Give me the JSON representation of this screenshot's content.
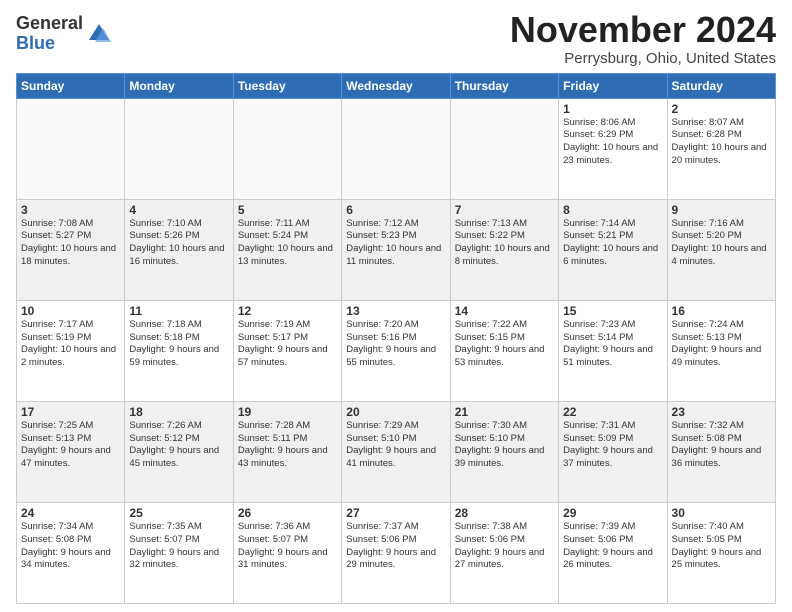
{
  "header": {
    "logo_general": "General",
    "logo_blue": "Blue",
    "month_title": "November 2024",
    "location": "Perrysburg, Ohio, United States"
  },
  "weekdays": [
    "Sunday",
    "Monday",
    "Tuesday",
    "Wednesday",
    "Thursday",
    "Friday",
    "Saturday"
  ],
  "weeks": [
    [
      {
        "day": "",
        "info": ""
      },
      {
        "day": "",
        "info": ""
      },
      {
        "day": "",
        "info": ""
      },
      {
        "day": "",
        "info": ""
      },
      {
        "day": "",
        "info": ""
      },
      {
        "day": "1",
        "info": "Sunrise: 8:06 AM\nSunset: 6:29 PM\nDaylight: 10 hours\nand 23 minutes."
      },
      {
        "day": "2",
        "info": "Sunrise: 8:07 AM\nSunset: 6:28 PM\nDaylight: 10 hours\nand 20 minutes."
      }
    ],
    [
      {
        "day": "3",
        "info": "Sunrise: 7:08 AM\nSunset: 5:27 PM\nDaylight: 10 hours\nand 18 minutes."
      },
      {
        "day": "4",
        "info": "Sunrise: 7:10 AM\nSunset: 5:26 PM\nDaylight: 10 hours\nand 16 minutes."
      },
      {
        "day": "5",
        "info": "Sunrise: 7:11 AM\nSunset: 5:24 PM\nDaylight: 10 hours\nand 13 minutes."
      },
      {
        "day": "6",
        "info": "Sunrise: 7:12 AM\nSunset: 5:23 PM\nDaylight: 10 hours\nand 11 minutes."
      },
      {
        "day": "7",
        "info": "Sunrise: 7:13 AM\nSunset: 5:22 PM\nDaylight: 10 hours\nand 8 minutes."
      },
      {
        "day": "8",
        "info": "Sunrise: 7:14 AM\nSunset: 5:21 PM\nDaylight: 10 hours\nand 6 minutes."
      },
      {
        "day": "9",
        "info": "Sunrise: 7:16 AM\nSunset: 5:20 PM\nDaylight: 10 hours\nand 4 minutes."
      }
    ],
    [
      {
        "day": "10",
        "info": "Sunrise: 7:17 AM\nSunset: 5:19 PM\nDaylight: 10 hours\nand 2 minutes."
      },
      {
        "day": "11",
        "info": "Sunrise: 7:18 AM\nSunset: 5:18 PM\nDaylight: 9 hours\nand 59 minutes."
      },
      {
        "day": "12",
        "info": "Sunrise: 7:19 AM\nSunset: 5:17 PM\nDaylight: 9 hours\nand 57 minutes."
      },
      {
        "day": "13",
        "info": "Sunrise: 7:20 AM\nSunset: 5:16 PM\nDaylight: 9 hours\nand 55 minutes."
      },
      {
        "day": "14",
        "info": "Sunrise: 7:22 AM\nSunset: 5:15 PM\nDaylight: 9 hours\nand 53 minutes."
      },
      {
        "day": "15",
        "info": "Sunrise: 7:23 AM\nSunset: 5:14 PM\nDaylight: 9 hours\nand 51 minutes."
      },
      {
        "day": "16",
        "info": "Sunrise: 7:24 AM\nSunset: 5:13 PM\nDaylight: 9 hours\nand 49 minutes."
      }
    ],
    [
      {
        "day": "17",
        "info": "Sunrise: 7:25 AM\nSunset: 5:13 PM\nDaylight: 9 hours\nand 47 minutes."
      },
      {
        "day": "18",
        "info": "Sunrise: 7:26 AM\nSunset: 5:12 PM\nDaylight: 9 hours\nand 45 minutes."
      },
      {
        "day": "19",
        "info": "Sunrise: 7:28 AM\nSunset: 5:11 PM\nDaylight: 9 hours\nand 43 minutes."
      },
      {
        "day": "20",
        "info": "Sunrise: 7:29 AM\nSunset: 5:10 PM\nDaylight: 9 hours\nand 41 minutes."
      },
      {
        "day": "21",
        "info": "Sunrise: 7:30 AM\nSunset: 5:10 PM\nDaylight: 9 hours\nand 39 minutes."
      },
      {
        "day": "22",
        "info": "Sunrise: 7:31 AM\nSunset: 5:09 PM\nDaylight: 9 hours\nand 37 minutes."
      },
      {
        "day": "23",
        "info": "Sunrise: 7:32 AM\nSunset: 5:08 PM\nDaylight: 9 hours\nand 36 minutes."
      }
    ],
    [
      {
        "day": "24",
        "info": "Sunrise: 7:34 AM\nSunset: 5:08 PM\nDaylight: 9 hours\nand 34 minutes."
      },
      {
        "day": "25",
        "info": "Sunrise: 7:35 AM\nSunset: 5:07 PM\nDaylight: 9 hours\nand 32 minutes."
      },
      {
        "day": "26",
        "info": "Sunrise: 7:36 AM\nSunset: 5:07 PM\nDaylight: 9 hours\nand 31 minutes."
      },
      {
        "day": "27",
        "info": "Sunrise: 7:37 AM\nSunset: 5:06 PM\nDaylight: 9 hours\nand 29 minutes."
      },
      {
        "day": "28",
        "info": "Sunrise: 7:38 AM\nSunset: 5:06 PM\nDaylight: 9 hours\nand 27 minutes."
      },
      {
        "day": "29",
        "info": "Sunrise: 7:39 AM\nSunset: 5:06 PM\nDaylight: 9 hours\nand 26 minutes."
      },
      {
        "day": "30",
        "info": "Sunrise: 7:40 AM\nSunset: 5:05 PM\nDaylight: 9 hours\nand 25 minutes."
      }
    ]
  ]
}
